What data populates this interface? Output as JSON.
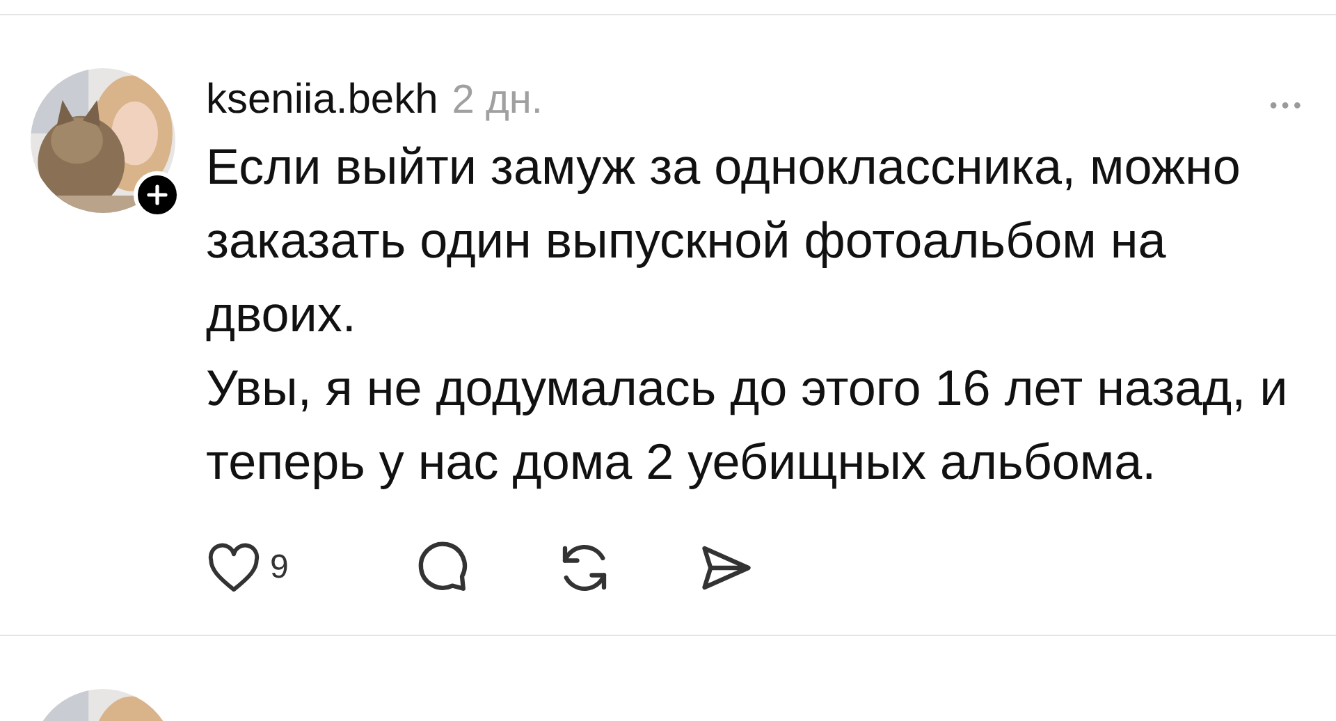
{
  "post": {
    "username": "kseniia.bekh",
    "time": "2 дн.",
    "more": "•••",
    "paragraphs": [
      "Если выйти замуж за одноклассника, можно заказать один выпускной фотоальбом на двоих.",
      "Увы, я не додумалась до этого 16 лет назад, и теперь у нас дома 2 уебищных альбома."
    ],
    "likes": "9",
    "liked": false
  }
}
